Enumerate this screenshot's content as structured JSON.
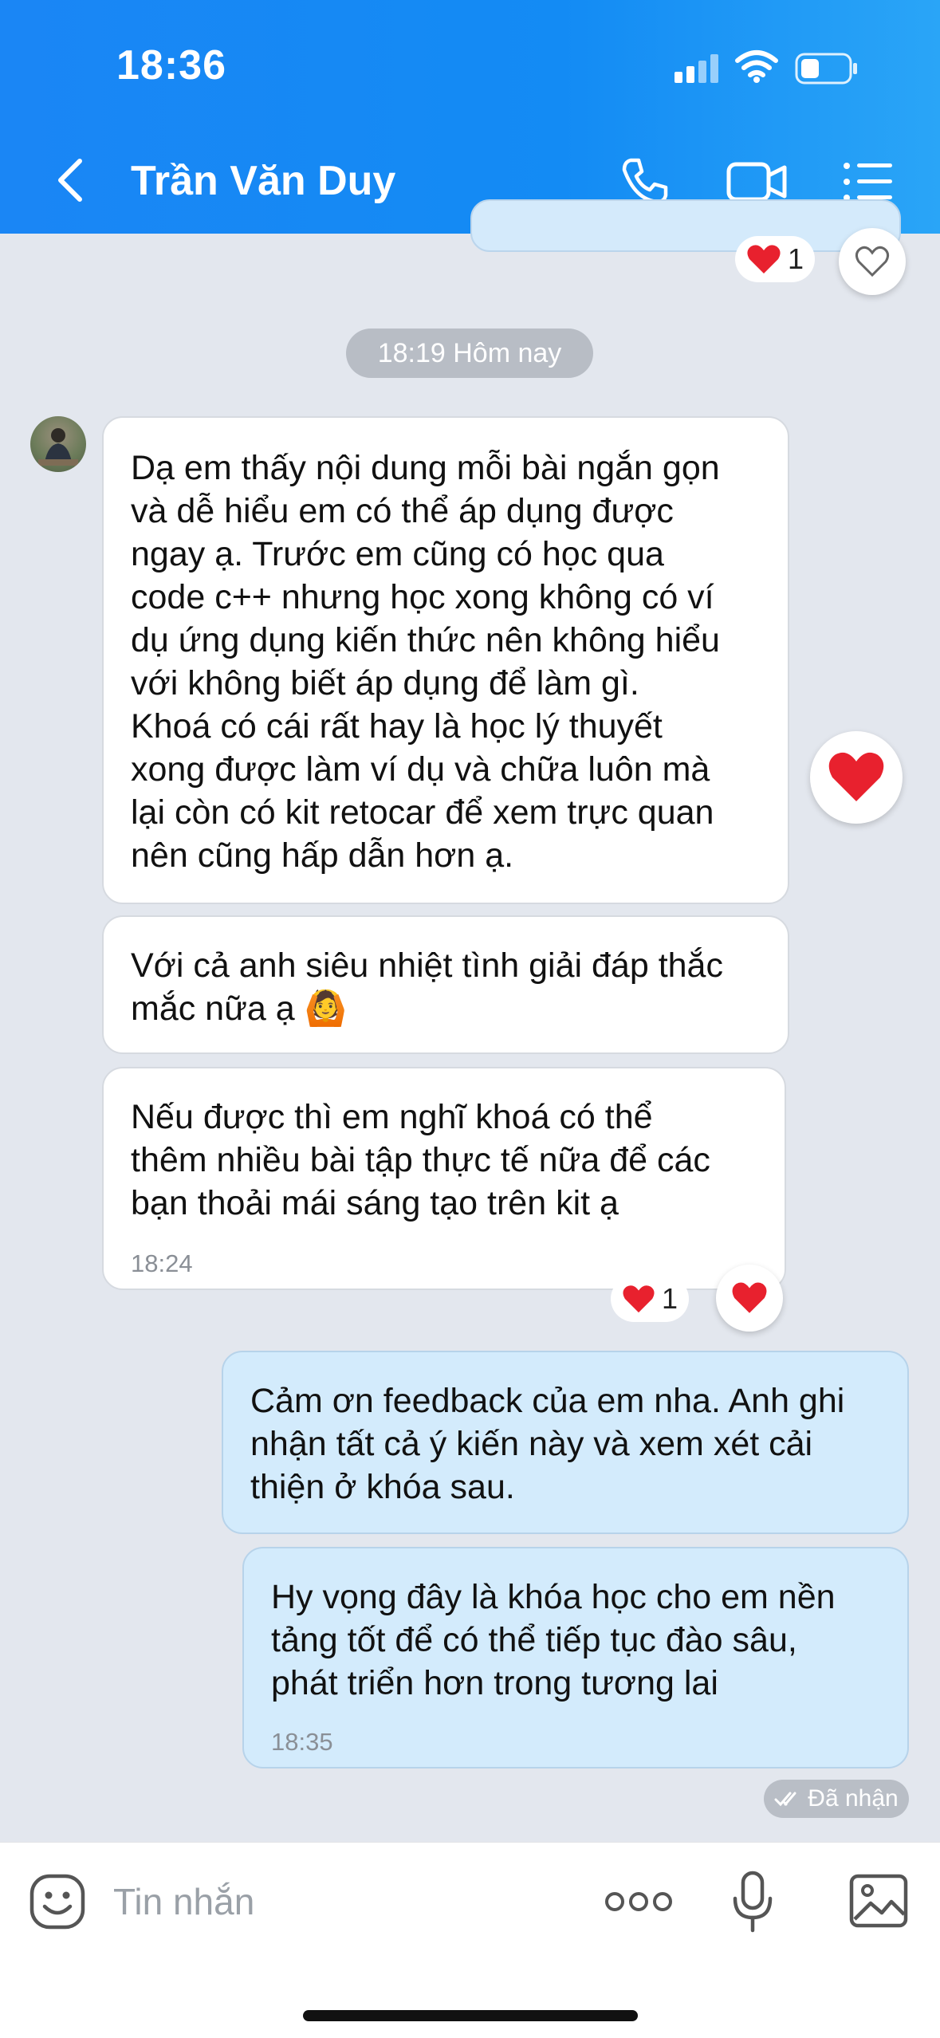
{
  "status_bar": {
    "time": "18:36"
  },
  "header": {
    "title": "Trần Văn Duy",
    "icons": [
      "back-arrow-icon",
      "phone-icon",
      "video-camera-icon",
      "list-menu-icon"
    ],
    "gradient_colors": [
      "#1A86F5",
      "#2AA5F7"
    ]
  },
  "previous_reaction": {
    "count": "1"
  },
  "time_divider": "18:19 Hôm nay",
  "messages": [
    {
      "from": "contact",
      "lines": [
        "Dạ em thấy nội dung mỗi bài ngắn gọn",
        "và dễ hiểu em có thể áp dụng được",
        "ngay ạ. Trước em cũng có học qua",
        "code c++ nhưng học xong không có ví",
        "dụ ứng dụng kiến thức nên không hiểu",
        "với không biết áp dụng để làm gì.",
        "Khoá có cái rất hay là học lý thuyết",
        "xong được làm ví dụ và chữa luôn mà",
        "lại còn có kit retocar để xem trực quan",
        "nên cũng hấp dẫn hơn ạ."
      ]
    },
    {
      "from": "contact",
      "lines": [
        "Với cả anh siêu nhiệt tình giải đáp thắc",
        "mắc nữa ạ"
      ],
      "emoji": "🙆"
    },
    {
      "from": "contact",
      "lines": [
        "Nếu được thì em nghĩ khoá có thể",
        "thêm nhiều bài tập thực tế nữa để các",
        "bạn thoải mái sáng tạo trên kit ạ"
      ],
      "time": "18:24",
      "reaction_count": "1"
    },
    {
      "from": "me",
      "lines": [
        "Cảm ơn feedback của em nha. Anh ghi",
        "nhận tất cả ý kiến này và xem xét cải",
        "thiện ở khóa sau."
      ]
    },
    {
      "from": "me",
      "lines": [
        "Hy vọng đây là khóa học cho em nền",
        "tảng tốt để có thể tiếp tục đào sâu,",
        "phát triển hơn trong tương lai"
      ],
      "time": "18:35"
    }
  ],
  "delivery_status": "Đã nhận",
  "input_bar": {
    "placeholder": "Tin nhắn",
    "icons": [
      "sticker-icon",
      "more-dots-icon",
      "microphone-icon",
      "image-icon"
    ]
  },
  "colors": {
    "chat_background": "#E3E7EE",
    "outgoing_bubble": "#D3EBFC",
    "incoming_bubble": "#FFFFFF",
    "heart": "#E8212E"
  }
}
